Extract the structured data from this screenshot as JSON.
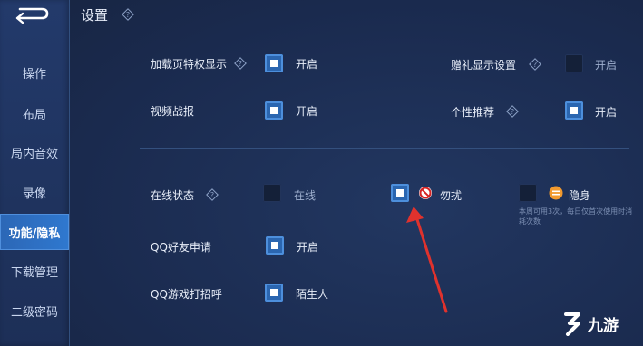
{
  "header": {
    "title": "设置"
  },
  "sidebar": {
    "items": [
      {
        "label": "操作"
      },
      {
        "label": "布局"
      },
      {
        "label": "局内音效"
      },
      {
        "label": "录像"
      },
      {
        "label": "功能/隐私"
      },
      {
        "label": "下载管理"
      },
      {
        "label": "二级密码"
      }
    ],
    "active_index": 4
  },
  "settings": {
    "loading_privilege": {
      "label": "加载页特权显示",
      "option": "开启",
      "checked": true
    },
    "gift_display": {
      "label": "赠礼显示设置",
      "option": "开启",
      "checked": false
    },
    "video_report": {
      "label": "视频战报",
      "option": "开启",
      "checked": true
    },
    "personal_recommend": {
      "label": "个性推荐",
      "option": "开启",
      "checked": true
    },
    "online_status": {
      "label": "在线状态",
      "options": [
        {
          "text": "在线",
          "checked": false
        },
        {
          "text": "勿扰",
          "checked": true
        },
        {
          "text": "隐身",
          "checked": false
        }
      ],
      "note": "本周可用3次，每日仅首次使用时消耗次数"
    },
    "qq_friend_request": {
      "label": "QQ好友申请",
      "option": "开启",
      "checked": true
    },
    "qq_game_greeting": {
      "label": "QQ游戏打招呼",
      "option": "陌生人",
      "checked": true
    }
  },
  "watermark": {
    "text": "九游"
  },
  "colors": {
    "accent": "#2b66b0",
    "arrow": "#e0322d",
    "dnd_icon": "#d42424",
    "hide_icon": "#f29a2e"
  }
}
